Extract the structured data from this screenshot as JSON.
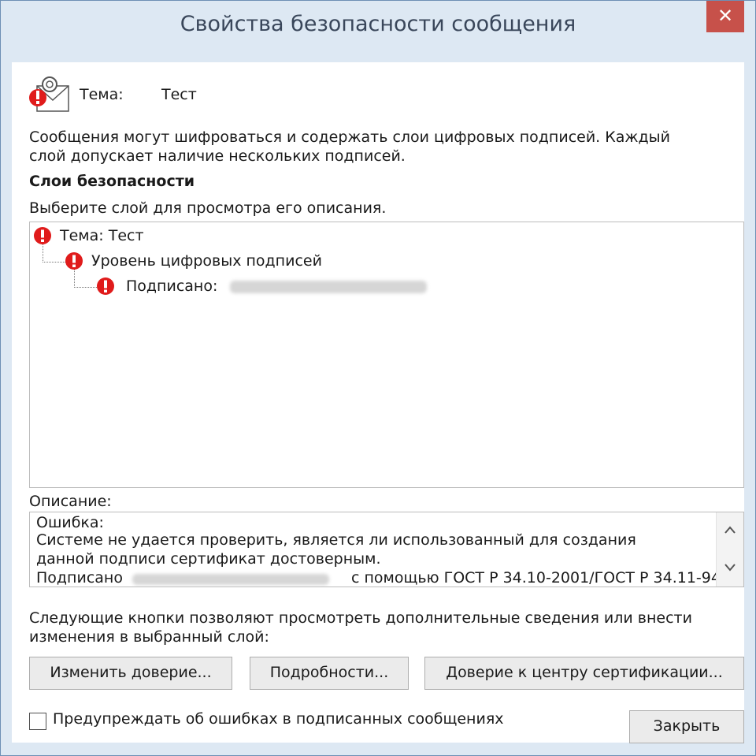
{
  "window": {
    "title": "Свойства безопасности сообщения",
    "close_glyph": "✕"
  },
  "header": {
    "subject_label": "Тема:",
    "subject_value": "Тест"
  },
  "intro": {
    "line1": "Сообщения могут шифроваться и содержать слои цифровых подписей. Каждый",
    "line2": "слой допускает наличие нескольких подписей."
  },
  "layers": {
    "heading": "Слои безопасности",
    "hint": "Выберите слой для просмотра его описания.",
    "items": [
      {
        "label": "Тема: Тест"
      },
      {
        "label": "Уровень цифровых подписей"
      },
      {
        "label": "Подписано:"
      }
    ]
  },
  "description": {
    "label": "Описание:",
    "lines": [
      "Ошибка:",
      "Системе не удается проверить, является ли использованный для создания",
      "данной подписи сертификат достоверным.",
      "Подписано",
      "с помощью ГОСТ Р 34.10-2001/ГОСТ Р 34.11-94"
    ]
  },
  "buttons_info": {
    "line1": "Следующие кнопки позволяют просмотреть дополнительные сведения или внести",
    "line2": "изменения в выбранный слой:"
  },
  "buttons": {
    "change_trust": "Изменить доверие...",
    "details": "Подробности...",
    "ca_trust": "Доверие к центру сертификации...",
    "close": "Закрыть"
  },
  "footer": {
    "warn_checkbox_label": "Предупреждать об ошибках в подписанных сообщениях",
    "warn_checked": false
  },
  "colors": {
    "title_bar": "#dde8f3",
    "close_button": "#c7514a",
    "error_red": "#e01b1b"
  }
}
